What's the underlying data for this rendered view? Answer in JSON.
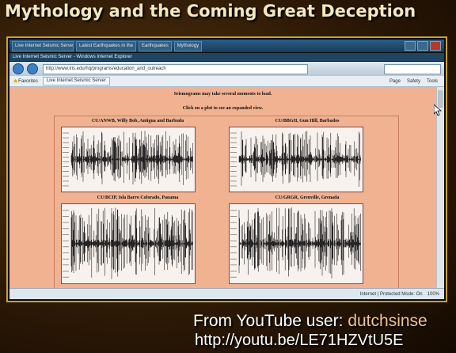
{
  "slide": {
    "title": "Mythology and the Coming Great Deception"
  },
  "browser": {
    "tabs": [
      "Live Internet Seismic Server",
      "Latest Earthquakes in the",
      "Earthquakes",
      "Mythology"
    ],
    "window_title": "Live Internet Seismic Server - Windows Internet Explorer",
    "address": "http://www.iris.edu/hq/programs/education_and_outreach",
    "favorites_label": "Favorites",
    "active_tab": "Live Internet Seismic Server",
    "command_bar": [
      "Page",
      "Safety",
      "Tools"
    ],
    "status_zone": "Internet | Protected Mode: On",
    "zoom": "100%"
  },
  "page": {
    "note": "Seismograms may take several moments to load.",
    "instruction": "Click on a plot to see an expanded view.",
    "plots": [
      {
        "caption": "CU/ANWB, Willy Bob, Antigua and Barbuda"
      },
      {
        "caption": "CU/BBGH, Gun Hill, Barbados"
      },
      {
        "caption": "CU/BCIP, Isla Barro Colorado, Panama"
      },
      {
        "caption": "CU/GRGR, Grenville, Grenada"
      }
    ]
  },
  "credit": {
    "prefix": "From YouTube user: ",
    "user": "dutchsinse",
    "url": "http://youtu.be/LE71HZVtU5E"
  },
  "colors": {
    "page_background": "#f0b291",
    "slide_title": "#f3e7c2",
    "frame_border": "#c9a033"
  }
}
